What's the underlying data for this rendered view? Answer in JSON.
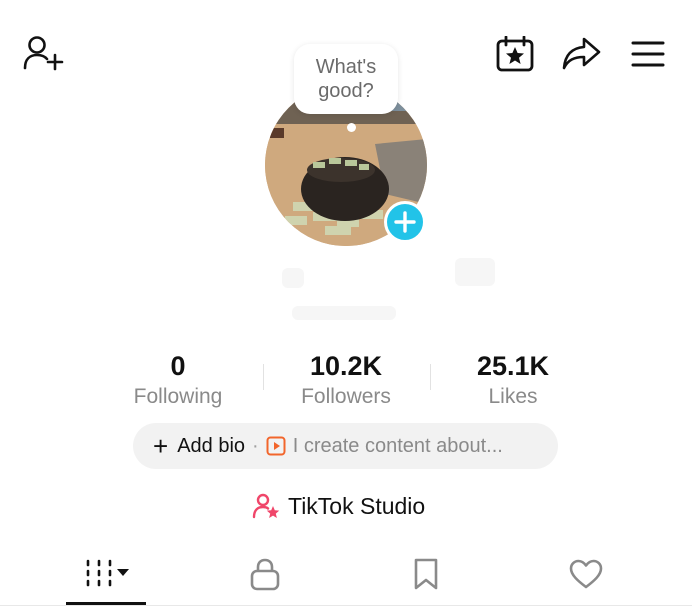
{
  "header": {
    "icons": {
      "add_friend": "person-add-icon",
      "events": "calendar-star-icon",
      "share": "share-arrow-icon",
      "menu": "hamburger-menu-icon"
    }
  },
  "profile": {
    "tooltip_text": "What's good?",
    "add_photo_icon": "plus-icon",
    "accent_color": "#22c3e8"
  },
  "stats": [
    {
      "value": "0",
      "label": "Following"
    },
    {
      "value": "10.2K",
      "label": "Followers"
    },
    {
      "value": "25.1K",
      "label": "Likes"
    }
  ],
  "bio": {
    "add_label": "Add bio",
    "separator": "·",
    "hint": "I create content about...",
    "hint_icon": "play-square-icon",
    "hint_icon_color": "#f2652b"
  },
  "studio": {
    "label": "TikTok Studio",
    "icon": "person-star-icon",
    "icon_color": "#f0466a"
  },
  "tabs": [
    {
      "name": "videos",
      "icon": "grid-bars-icon",
      "selected": true
    },
    {
      "name": "private",
      "icon": "lock-icon",
      "selected": false
    },
    {
      "name": "saved",
      "icon": "bookmark-icon",
      "selected": false
    },
    {
      "name": "liked",
      "icon": "heart-icon",
      "selected": false
    }
  ]
}
